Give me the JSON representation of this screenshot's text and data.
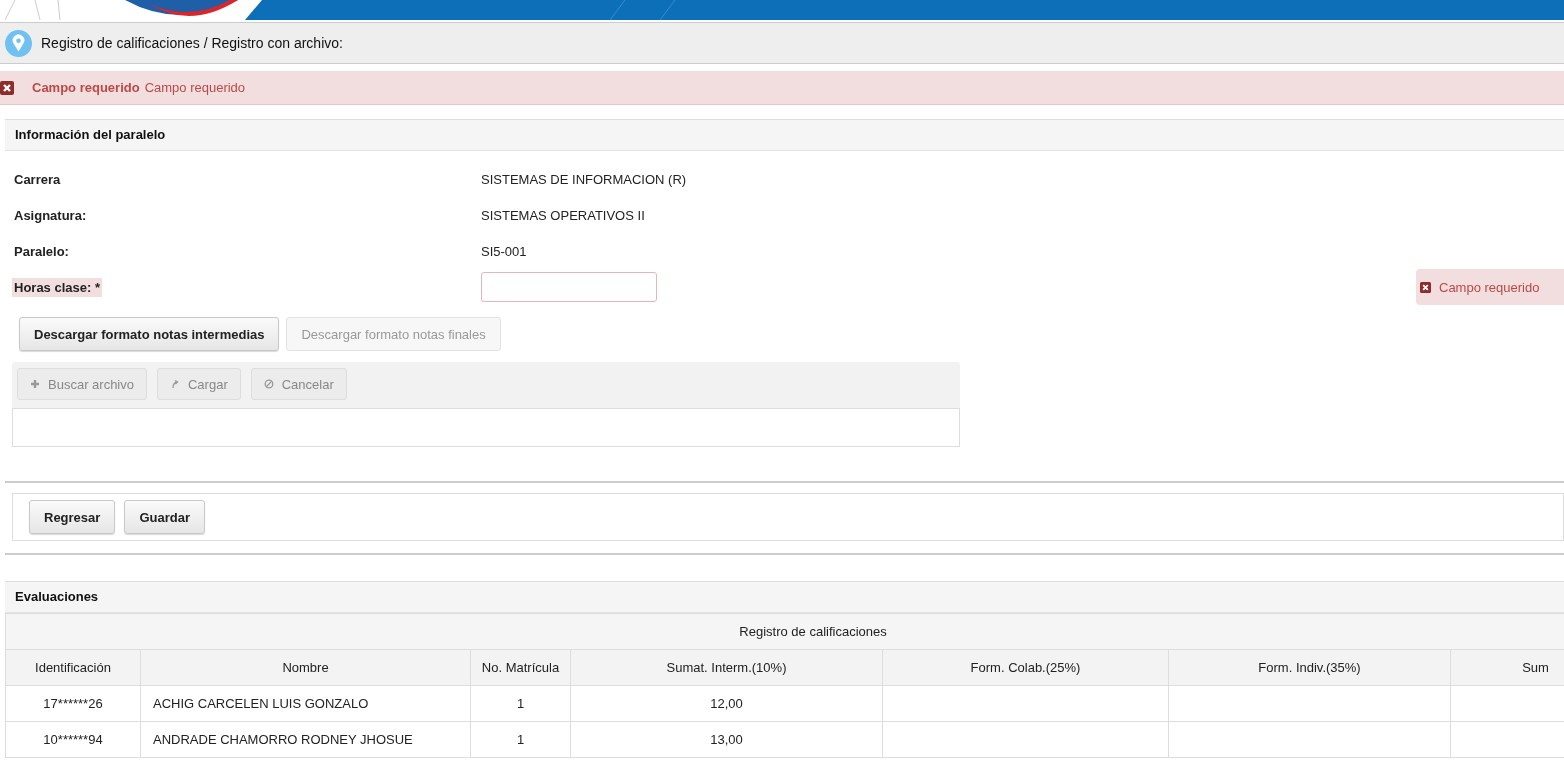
{
  "breadcrumb": "Registro de calificaciones / Registro con archivo:",
  "error_banner": {
    "summary": "Campo requerido",
    "detail": "Campo requerido"
  },
  "info_panel": {
    "title": "Información del paralelo",
    "fields": [
      {
        "label": "Carrera",
        "kind": "text",
        "value": "SISTEMAS DE INFORMACION (R)"
      },
      {
        "label": "Asignatura:",
        "kind": "text",
        "value": "SISTEMAS OPERATIVOS II"
      },
      {
        "label": "Paralelo:",
        "kind": "text",
        "value": "SI5-001"
      },
      {
        "label": "Horas clase:",
        "kind": "input",
        "required_mark": "*",
        "error": true,
        "message": "Campo requerido"
      }
    ],
    "download_buttons": [
      {
        "label": "Descargar formato notas intermedias",
        "disabled": false
      },
      {
        "label": "Descargar formato notas finales",
        "disabled": true
      }
    ],
    "upload_buttons": [
      {
        "label": "Buscar archivo",
        "disabled": true
      },
      {
        "label": "Cargar",
        "disabled": true
      },
      {
        "label": "Cancelar",
        "disabled": true
      }
    ]
  },
  "action_buttons": [
    {
      "label": "Regresar"
    },
    {
      "label": "Guardar"
    }
  ],
  "evaluations": {
    "title": "Evaluaciones",
    "group_header": "Registro de calificaciones",
    "columns": [
      "Identificación",
      "Nombre",
      "No. Matrícula",
      "Sumat. Interm.(10%)",
      "Form. Colab.(25%)",
      "Form. Indiv.(35%)",
      "Sum"
    ],
    "rows": [
      [
        "17******26",
        "ACHIG CARCELEN LUIS GONZALO",
        "1",
        "12,00",
        "",
        "",
        ""
      ],
      [
        "10******94",
        "ANDRADE CHAMORRO RODNEY JHOSUE",
        "1",
        "13,00",
        "",
        "",
        ""
      ]
    ]
  }
}
